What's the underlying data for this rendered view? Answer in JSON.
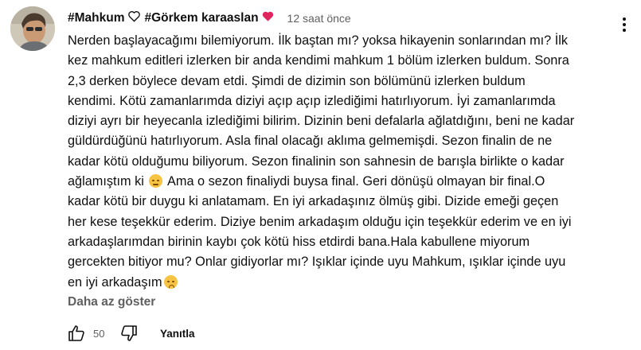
{
  "comment": {
    "author": "#Mahkum",
    "author_suffix": "#Görkem karaaslan",
    "timestamp": "12 saat önce",
    "lines": [
      "Nerden başlayacağımı bilemiyorum. İlk baştan mı? yoksa hikayenin sonlarından mı? İlk",
      "kez mahkum editleri izlerken bir anda kendimi mahkum 1 bölüm izlerken buldum. Sonra",
      "2,3 derken böylece devam etdi. Şimdi de dizimin son bölümünü izlerken buldum",
      "kendimi. Kötü zamanlarımda diziyi açıp açıp izlediğimi hatırlıyorum. İyi zamanlarımda",
      "diziyi ayrı bir heyecanla izlediğimi bilirim. Dizinin beni defalarla ağlatdığını, beni ne kadar",
      "güldürdüğünü hatırlıyorum. Asla final olacağı aklıma gelmemişdi. Sezon finalin de ne",
      "kadar kötü olduğumu biliyorum. Sezon finalinin son sahnesin de barışla birlikte o kadar"
    ],
    "line8_before_emoji": "ağlamıştım ki ",
    "line8_after_emoji": " Ama o sezon finaliydi buysa final. Geri dönüşü olmayan bir final.O",
    "lines_after": [
      "kadar kötü bir duygu ki anlatamam. En iyi arkadaşınız ölmüş gibi. Dizide emeği geçen",
      "her kese teşekkür ederim. Diziye benim arkadaşım olduğu için teşekkür ederim ve en iyi",
      "arkadaşlarımdan birinin kaybı çok kötü hiss etdirdi bana.Hala kabullene miyorum",
      "gercekten bitiyor mu? Onlar gidiyorlar mı? Işıklar içinde uyu Mahkum, ışıklar içinde uyu"
    ],
    "last_line": "en iyi arkadaşım",
    "show_less_label": "Daha az göster",
    "like_count": "50",
    "reply_label": "Yanıtla"
  },
  "colors": {
    "text": "#0f0f0f",
    "secondary": "#606060",
    "heart_red": "#e0245e"
  },
  "icons": [
    "avatar",
    "heart-outline-icon",
    "heart-red-icon",
    "more-vert-icon",
    "sad-face-emoji",
    "pleading-face-emoji",
    "thumb-up-icon",
    "thumb-down-icon"
  ]
}
